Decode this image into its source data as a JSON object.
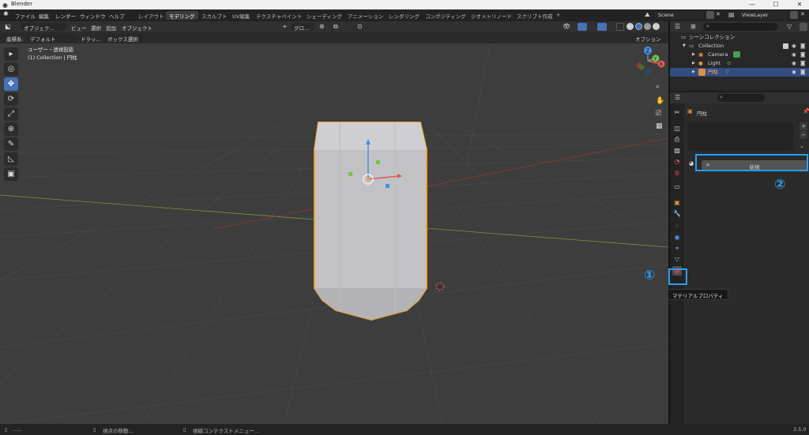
{
  "window": {
    "title": "Blender",
    "minimize": "—",
    "maximize": "☐",
    "close": "✕"
  },
  "menubar": [
    "ファイル",
    "編集",
    "レンダー",
    "ウィンドウ",
    "ヘルプ"
  ],
  "workspaces": [
    "レイアウト",
    "モデリング",
    "スカルプト",
    "UV編集",
    "テクスチャペイント",
    "シェーディング",
    "アニメーション",
    "レンダリング",
    "コンポジティング",
    "ジオメトリノード",
    "スクリプト作成",
    "+"
  ],
  "active_workspace": "モデリング",
  "scene": {
    "name": "Scene",
    "view_layer": "ViewLayer"
  },
  "viewport_header": {
    "mode": "オブジェク...",
    "menus": [
      "ビュー",
      "選択",
      "追加",
      "オブジェクト"
    ],
    "transform": "グロ...",
    "options": "オプション"
  },
  "viewport_header2": {
    "orientation_label": "座標系:",
    "orientation": "デフォルト",
    "drag_label": "ドラッ...",
    "select_mode": "ボックス選択"
  },
  "viewport_info": {
    "line1": "ユーザー・透視投影",
    "line2": "(1) Collection | 円柱"
  },
  "tools": [
    "select",
    "cursor",
    "move",
    "rotate",
    "scale",
    "transform",
    "annotate",
    "measure",
    "add-cube"
  ],
  "gizmo": {
    "z": "Z",
    "y": "Y",
    "x": "X"
  },
  "outliner": {
    "root": "シーンコレクション",
    "collection": "Collection",
    "items": [
      "Camera",
      "Light",
      "円柱"
    ]
  },
  "properties": {
    "object_name": "円柱",
    "new_button": "新規",
    "search_placeholder": ""
  },
  "tooltip": "マテリアルプロパティ",
  "annotations": {
    "one": "①",
    "two": "②"
  },
  "statusbar": {
    "left": "......",
    "mid1": "視点の移動...",
    "mid2": "視線コンテクストメニュー...",
    "version": "3.5.0"
  },
  "colors": {
    "accent": "#4772b3",
    "callout": "#2a9df4",
    "selection_outline": "#f0a030"
  }
}
